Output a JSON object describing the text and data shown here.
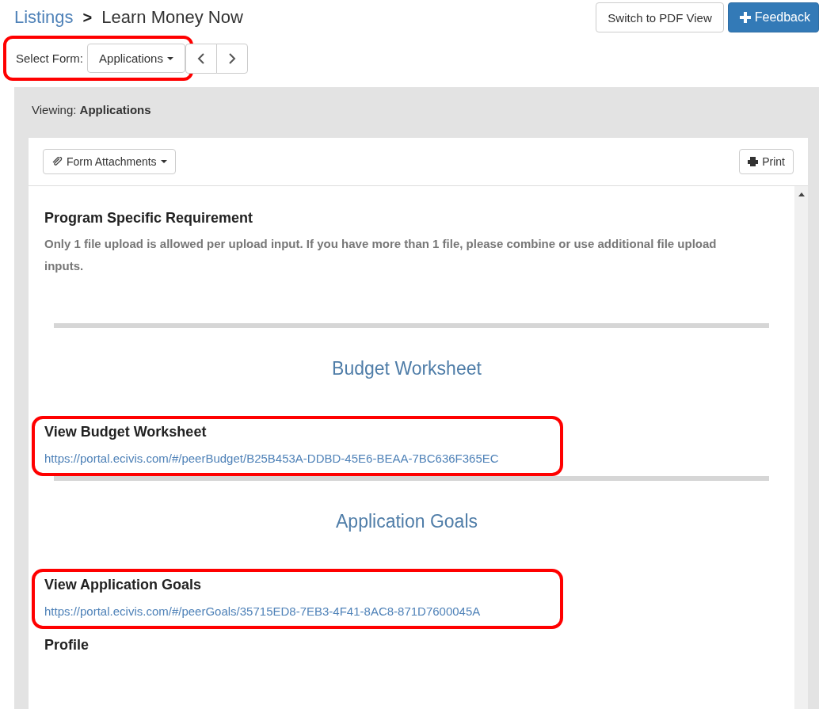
{
  "breadcrumb": {
    "parent": "Listings",
    "separator": ">",
    "current": "Learn Money Now"
  },
  "header_buttons": {
    "pdf": "Switch to PDF View",
    "feedback": "Feedback"
  },
  "form_select": {
    "label": "Select Form:",
    "value": "Applications",
    "highlighted": true
  },
  "viewing": {
    "label": "Viewing:",
    "value": "Applications"
  },
  "toolbar": {
    "attachments": "Form Attachments",
    "print": "Print"
  },
  "items": [
    {
      "kind": "field",
      "title": "Program Specific Requirement",
      "text": "Only 1 file upload is allowed per upload input. If you have more than 1 file, please combine or use additional file upload inputs.",
      "highlighted": false
    },
    {
      "kind": "divider"
    },
    {
      "kind": "heading",
      "title": "Budget Worksheet"
    },
    {
      "kind": "link",
      "title": "View Budget Worksheet",
      "url": "https://portal.ecivis.com/#/peerBudget/B25B453A-DDBD-45E6-BEAA-7BC636F365EC",
      "highlighted": true
    },
    {
      "kind": "divider"
    },
    {
      "kind": "heading",
      "title": "Application Goals"
    },
    {
      "kind": "link",
      "title": "View Application Goals",
      "url": "https://portal.ecivis.com/#/peerGoals/35715ED8-7EB3-4F41-8AC8-871D7600045A",
      "highlighted": true
    },
    {
      "kind": "field",
      "title": "Profile",
      "highlighted": false
    }
  ]
}
